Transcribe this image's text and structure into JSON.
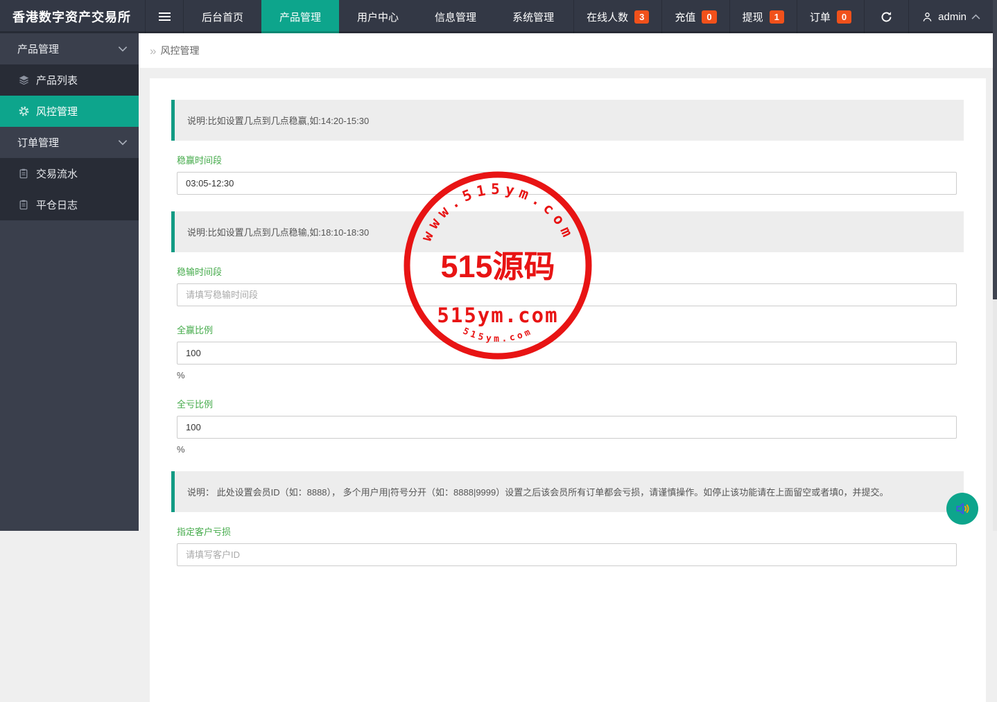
{
  "app": {
    "title": "香港数字资产交易所"
  },
  "topnav": {
    "tabs": [
      {
        "label": "后台首页",
        "active": false
      },
      {
        "label": "产品管理",
        "active": true
      },
      {
        "label": "用户中心",
        "active": false
      },
      {
        "label": "信息管理",
        "active": false
      },
      {
        "label": "系统管理",
        "active": false
      }
    ],
    "stats": [
      {
        "label": "在线人数",
        "count": "3"
      },
      {
        "label": "充值",
        "count": "0"
      },
      {
        "label": "提现",
        "count": "1"
      },
      {
        "label": "订单",
        "count": "0"
      }
    ],
    "user": {
      "name": "admin"
    }
  },
  "sidebar": {
    "groups": [
      {
        "label": "产品管理",
        "items": [
          {
            "label": "产品列表",
            "icon": "layers-icon",
            "active": false
          },
          {
            "label": "风控管理",
            "icon": "gear-icon",
            "active": true
          }
        ]
      },
      {
        "label": "订单管理",
        "items": [
          {
            "label": "交易流水",
            "icon": "clipboard-icon",
            "active": false
          },
          {
            "label": "平仓日志",
            "icon": "clipboard-icon",
            "active": false
          }
        ]
      }
    ]
  },
  "breadcrumb": {
    "title": "风控管理"
  },
  "form": {
    "notes": [
      "说明:比如设置几点到几点稳赢,如:14:20-15:30",
      "说明:比如设置几点到几点稳输,如:18:10-18:30",
      "说明： 此处设置会员ID（如：8888）， 多个用户用|符号分开（如：8888|9999）设置之后该会员所有订单都会亏损，请谨慎操作。如停止该功能请在上面留空或者填0，并提交。"
    ],
    "fields": [
      {
        "label": "稳赢时间段",
        "value": "03:05-12:30",
        "placeholder": ""
      },
      {
        "label": "稳输时间段",
        "value": "",
        "placeholder": "请填写稳输时间段"
      },
      {
        "label": "全赢比例",
        "value": "100",
        "unit": "%"
      },
      {
        "label": "全亏比例",
        "value": "100",
        "unit": "%"
      },
      {
        "label": "指定客户亏损",
        "value": "",
        "placeholder": "请填写客户ID"
      }
    ]
  },
  "watermark": {
    "arc_top": "www.515ym.com",
    "center": "515源码",
    "line": "515ym.com",
    "arc_bottom": "515ym.com",
    "color": "#e60000"
  },
  "colors": {
    "accent": "#0da58c",
    "badge": "#f1511b",
    "label_green": "#45ab4b"
  }
}
